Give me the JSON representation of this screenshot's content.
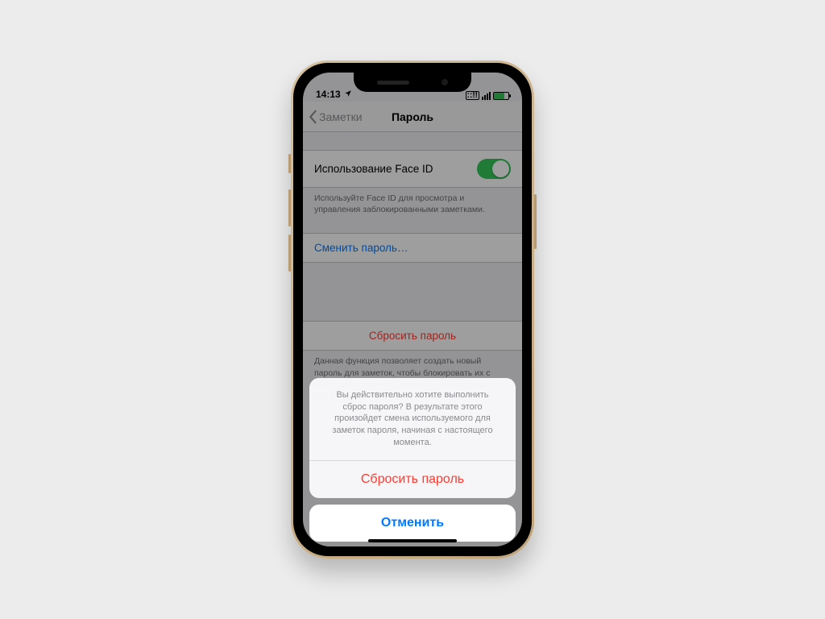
{
  "statusbar": {
    "time": "14:13"
  },
  "nav": {
    "back": "Заметки",
    "title": "Пароль"
  },
  "faceid": {
    "label": "Использование Face ID",
    "footer": "Используйте Face ID для просмотра и управления заблокированными заметками."
  },
  "change_password": "Сменить пароль…",
  "reset_password": {
    "label": "Сбросить пароль",
    "footer": "Данная функция позволяет создать новый пароль для заметок, чтобы блокировать их с настоящего момента. Заметки, уже имеющие пароль, затронуты не будут."
  },
  "sheet": {
    "message": "Вы действительно хотите выполнить сброс пароля? В результате этого произойдет смена используемого для заметок пароля, начиная с настоящего момента.",
    "destructive": "Сбросить пароль",
    "cancel": "Отменить"
  }
}
